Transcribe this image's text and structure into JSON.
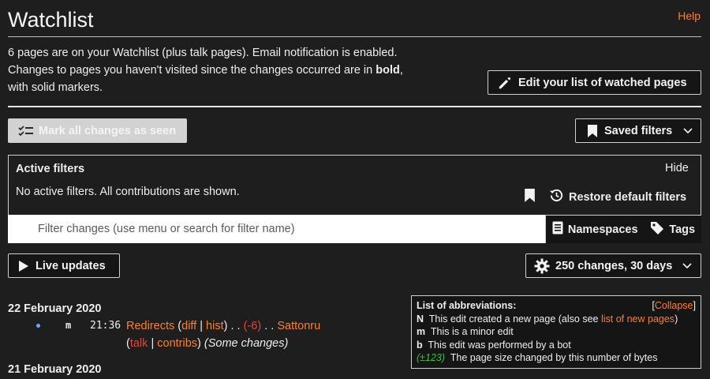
{
  "header": {
    "title": "Watchlist",
    "help": "Help"
  },
  "intro": {
    "line1": "6 pages are on your Watchlist (plus talk pages). Email notification is enabled.",
    "line2_pre": "Changes to pages you haven't visited since the changes occurred are in ",
    "line2_bold": "bold",
    "line2_post": ",",
    "line3": "with solid markers."
  },
  "edit_list_button": "Edit your list of watched pages",
  "mark_seen_button": "Mark all changes as seen",
  "saved_filters_button": "Saved filters",
  "filters": {
    "title": "Active filters",
    "hide": "Hide",
    "status": "No active filters. All contributions are shown.",
    "restore": "Restore default filters",
    "search_placeholder": "Filter changes (use menu or search for filter name)",
    "namespaces": "Namespaces",
    "tags": "Tags"
  },
  "live_updates_button": "Live updates",
  "changes_button": "250 changes, 30 days",
  "entries": {
    "date1": "22 February 2020",
    "row": {
      "minor_flag": "m",
      "time": "21:36",
      "page": "Redirects",
      "paren_open": "(",
      "diff": "diff",
      "sep": " | ",
      "hist": "hist",
      "paren_close": ")",
      "dots1": " . . ",
      "size": "(-6)",
      "dots2": " . . ",
      "user": "Sattonru",
      "talk": "talk",
      "contribs": "contribs",
      "summary": "(Some changes)"
    },
    "date2": "21 February 2020"
  },
  "abbreviations": {
    "title": "List of abbreviations:",
    "collapse_open": "[",
    "collapse": "Collapse",
    "collapse_close": "]",
    "items": [
      {
        "key": "N",
        "text": "This edit created a new page (also see ",
        "link": "list of new pages",
        "tail": ")"
      },
      {
        "key": "m",
        "text": "This is a minor edit"
      },
      {
        "key": "b",
        "text": "This edit was performed by a bot"
      },
      {
        "key": "(±123)",
        "text": "The page size changed by this number of bytes"
      }
    ]
  },
  "colors": {
    "background": "#1e1e1e",
    "link": "#ff7f2a",
    "negative": "#e0473a",
    "positive": "#3fbf3f"
  },
  "icons": [
    "edit-pencil-icon",
    "checklist-icon",
    "bookmark-icon",
    "history-restore-icon",
    "namespaces-icon",
    "tag-icon",
    "play-icon",
    "gear-icon",
    "chevron-down-icon"
  ]
}
